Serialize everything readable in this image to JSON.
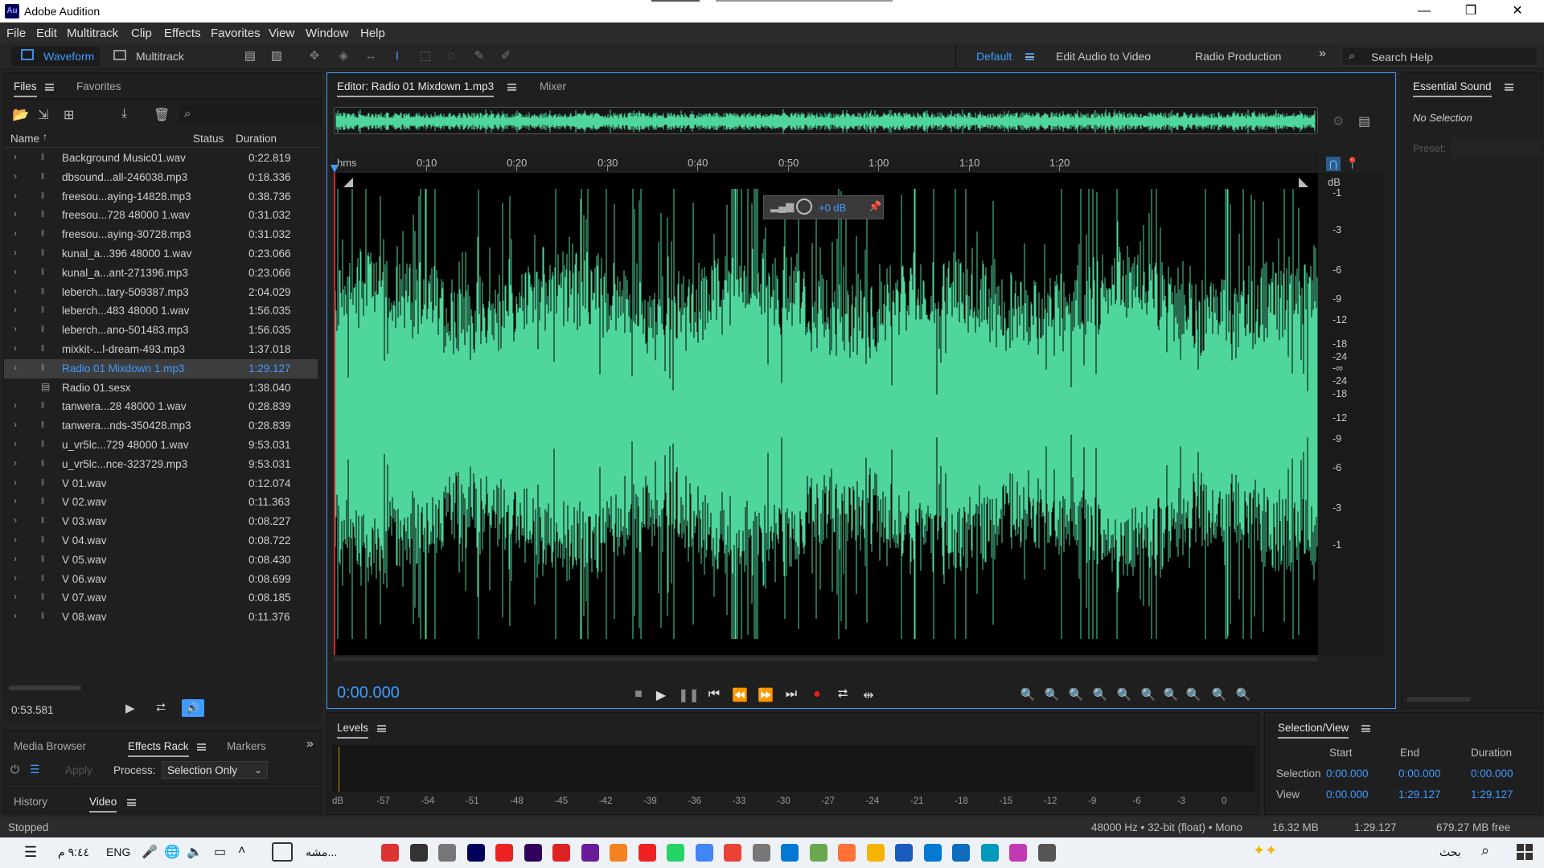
{
  "app": {
    "title": "Adobe Audition",
    "logo": "Au",
    "controls": {
      "minimize": "—",
      "maximize": "❐",
      "close": "✕"
    }
  },
  "menu": [
    "File",
    "Edit",
    "Multitrack",
    "Clip",
    "Effects",
    "Favorites",
    "View",
    "Window",
    "Help"
  ],
  "toolbar": {
    "waveform": "Waveform",
    "multitrack": "Multitrack",
    "workspaces": [
      "Default",
      "Edit Audio to Video",
      "Radio Production"
    ],
    "search_placeholder": "Search Help"
  },
  "files_panel": {
    "tabs": [
      "Files",
      "Favorites"
    ],
    "columns": {
      "name": "Name",
      "status": "Status",
      "duration": "Duration"
    },
    "rows": [
      {
        "name": "Background Music01.wav",
        "duration": "0:22.819"
      },
      {
        "name": "dbsound...all-246038.mp3",
        "duration": "0:18.336"
      },
      {
        "name": "freesou...aying-14828.mp3",
        "duration": "0:38.736"
      },
      {
        "name": "freesou...728 48000 1.wav",
        "duration": "0:31.032"
      },
      {
        "name": "freesou...aying-30728.mp3",
        "duration": "0:31.032"
      },
      {
        "name": "kunal_a...396 48000 1.wav",
        "duration": "0:23.066"
      },
      {
        "name": "kunal_a...ant-271396.mp3",
        "duration": "0:23.066"
      },
      {
        "name": "leberch...tary-509387.mp3",
        "duration": "2:04.029"
      },
      {
        "name": "leberch...483 48000 1.wav",
        "duration": "1:56.035"
      },
      {
        "name": "leberch...ano-501483.mp3",
        "duration": "1:56.035"
      },
      {
        "name": "mixkit-...l-dream-493.mp3",
        "duration": "1:37.018"
      },
      {
        "name": "Radio 01 Mixdown 1.mp3",
        "duration": "1:29.127",
        "selected": true
      },
      {
        "name": "Radio 01.sesx",
        "duration": "1:38.040",
        "session": true
      },
      {
        "name": "tanwera...28 48000 1.wav",
        "duration": "0:28.839"
      },
      {
        "name": "tanwera...nds-350428.mp3",
        "duration": "0:28.839"
      },
      {
        "name": "u_vr5lc...729 48000 1.wav",
        "duration": "9:53.031"
      },
      {
        "name": "u_vr5lc...nce-323729.mp3",
        "duration": "9:53.031"
      },
      {
        "name": "V 01.wav",
        "duration": "0:12.074"
      },
      {
        "name": "V 02.wav",
        "duration": "0:11.363"
      },
      {
        "name": "V 03.wav",
        "duration": "0:08.227"
      },
      {
        "name": "V 04.wav",
        "duration": "0:08.722"
      },
      {
        "name": "V 05.wav",
        "duration": "0:08.430"
      },
      {
        "name": "V 06.wav",
        "duration": "0:08.699"
      },
      {
        "name": "V 07.wav",
        "duration": "0:08.185"
      },
      {
        "name": "V 08.wav",
        "duration": "0:11.376"
      }
    ],
    "preview_time": "0:53.581"
  },
  "effects_panel": {
    "tabs": [
      "Media Browser",
      "Effects Rack",
      "Markers"
    ],
    "apply": "Apply",
    "process_label": "Process:",
    "process_value": "Selection Only"
  },
  "history_panel": {
    "tabs": [
      "History",
      "Video"
    ]
  },
  "status": {
    "left": "Stopped",
    "format": "48000 Hz • 32-bit (float) • Mono",
    "size": "16.32 MB",
    "duration": "1:29.127",
    "free": "679.27 MB free"
  },
  "editor": {
    "tabs": [
      "Editor: Radio 01 Mixdown 1.mp3",
      "Mixer"
    ],
    "ruler_unit": "hms",
    "ruler_ticks": [
      "0:10",
      "0:20",
      "0:30",
      "0:40",
      "0:50",
      "1:00",
      "1:10",
      "1:20"
    ],
    "db_unit": "dB",
    "db_labels": [
      "-1",
      "-3",
      "-6",
      "-9",
      "-12",
      "-18",
      "-24",
      "-∞",
      "-24",
      "-18",
      "-12",
      "-9",
      "-6",
      "-3",
      "-1"
    ],
    "hud_gain": "+0 dB",
    "current_time": "0:00.000",
    "waveform_color": "#4fd69c"
  },
  "essential_sound": {
    "title": "Essential Sound",
    "no_selection": "No Selection",
    "preset": "Preset:"
  },
  "levels": {
    "title": "Levels",
    "ticks": [
      "dB",
      "-57",
      "-54",
      "-51",
      "-48",
      "-45",
      "-42",
      "-39",
      "-36",
      "-33",
      "-30",
      "-27",
      "-24",
      "-21",
      "-18",
      "-15",
      "-12",
      "-9",
      "-6",
      "-3",
      "0"
    ]
  },
  "selection_view": {
    "title": "Selection/View",
    "cols": [
      "Start",
      "End",
      "Duration"
    ],
    "selection_label": "Selection",
    "view_label": "View",
    "selection": [
      "0:00.000",
      "0:00.000",
      "0:00.000"
    ],
    "view": [
      "0:00.000",
      "1:29.127",
      "1:29.127"
    ]
  },
  "taskbar": {
    "lang": "ENG",
    "time": "٩:٤٤ م",
    "search": "بحث",
    "search_item": "مشه..."
  }
}
